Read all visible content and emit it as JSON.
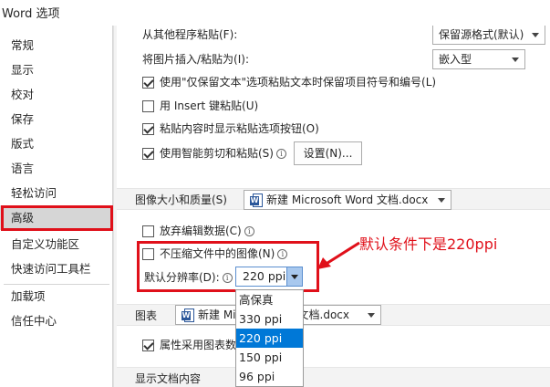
{
  "window": {
    "title": "Word 选项"
  },
  "sidebar": {
    "items": [
      {
        "label": "常规"
      },
      {
        "label": "显示"
      },
      {
        "label": "校对"
      },
      {
        "label": "保存"
      },
      {
        "label": "版式"
      },
      {
        "label": "语言"
      },
      {
        "label": "轻松访问"
      },
      {
        "label": "高级",
        "active": true
      },
      {
        "label": "自定义功能区"
      },
      {
        "label": "快速访问工具栏"
      },
      {
        "label": "加载项"
      },
      {
        "label": "信任中心"
      }
    ]
  },
  "paste": {
    "paste_from_other_label": "从其他程序粘贴(F):",
    "paste_from_other_value": "保留源格式(默认)",
    "insert_picture_label": "将图片插入/粘贴为(I):",
    "insert_picture_value": "嵌入型",
    "keep_bullets_label": "使用\"仅保留文本\"选项粘贴文本时保留项目符号和编号(L)",
    "insert_key_label": "用 Insert 键粘贴(U)",
    "show_paste_options_label": "粘贴内容时显示粘贴选项按钮(O)",
    "smart_cut_label": "使用智能剪切和粘贴(S)",
    "settings_button": "设置(N)..."
  },
  "image_quality": {
    "header": "图像大小和质量(S)",
    "document": "新建 Microsoft Word 文档.docx",
    "discard_edit_label": "放弃编辑数据(C)",
    "no_compress_label": "不压缩文件中的图像(N)",
    "default_resolution_label": "默认分辨率(D):",
    "default_resolution_value": "220 ppi",
    "resolution_options": [
      "高保真",
      "330 ppi",
      "220 ppi",
      "150 ppi",
      "96 ppi"
    ],
    "selected_option": "220 ppi"
  },
  "chart": {
    "header": "图表",
    "document_prefix": "新建 Mi",
    "document_suffix": "文档.docx",
    "properties_label": "属性采用图表数"
  },
  "display_doc": {
    "header": "显示文档内容"
  },
  "annotation": {
    "text": "默认条件下是220ppi",
    "color": "#e0101a"
  }
}
